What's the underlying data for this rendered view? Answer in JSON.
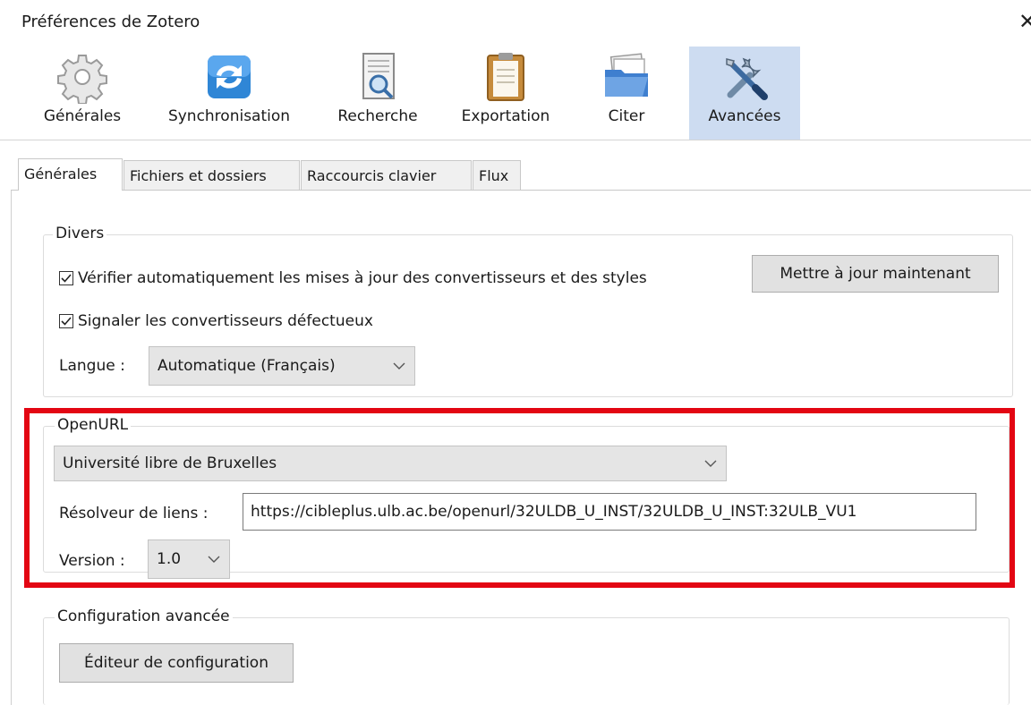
{
  "window": {
    "title": "Préférences de Zotero",
    "close_icon": "close-icon"
  },
  "toolbar": {
    "buttons": [
      {
        "label": "Générales",
        "icon": "gear-icon"
      },
      {
        "label": "Synchronisation",
        "icon": "sync-icon"
      },
      {
        "label": "Recherche",
        "icon": "search-document-icon"
      },
      {
        "label": "Exportation",
        "icon": "clipboard-icon"
      },
      {
        "label": "Citer",
        "icon": "folder-icon"
      },
      {
        "label": "Avancées",
        "icon": "tools-icon",
        "selected": true
      }
    ]
  },
  "tabs": [
    {
      "label": "Générales",
      "active": true
    },
    {
      "label": "Fichiers et dossiers"
    },
    {
      "label": "Raccourcis clavier"
    },
    {
      "label": "Flux"
    }
  ],
  "divers": {
    "legend": "Divers",
    "auto_update_label": "Vérifier automatiquement les mises à jour des convertisseurs et des styles",
    "auto_update_checked": true,
    "update_now_button": "Mettre à jour maintenant",
    "report_broken_label": "Signaler les convertisseurs défectueux",
    "report_broken_checked": true,
    "language_label": "Langue :",
    "language_value": "Automatique (Français)"
  },
  "openurl": {
    "legend": "OpenURL",
    "institution_value": "Université libre de Bruxelles",
    "resolver_label": "Résolveur de liens :",
    "resolver_value": "https://cibleplus.ulb.ac.be/openurl/32ULDB_U_INST/32ULDB_U_INST:32ULB_VU1",
    "version_label": "Version :",
    "version_value": "1.0"
  },
  "advanced_config": {
    "legend": "Configuration avancée",
    "editor_button": "Éditeur de configuration"
  },
  "colors": {
    "selected_toolbar_bg": "#cddcf1",
    "highlight_border": "#e30613"
  }
}
